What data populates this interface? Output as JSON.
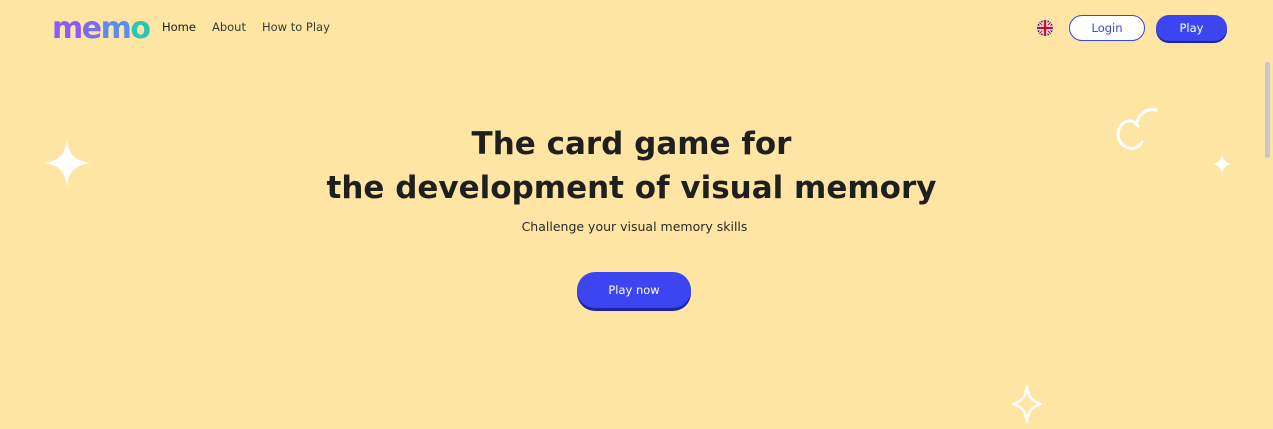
{
  "brand": {
    "logo_letters": [
      "m",
      "e",
      "m",
      "o"
    ],
    "colors": [
      "#8B5CF6",
      "#7C6CF0",
      "#5B8DEF",
      "#2EC4B6"
    ]
  },
  "nav": {
    "items": [
      {
        "label": "Home",
        "active": true
      },
      {
        "label": "About",
        "active": false
      },
      {
        "label": "How to Play",
        "active": false
      }
    ]
  },
  "header": {
    "language_icon": "uk-flag-icon",
    "login_label": "Login",
    "play_label": "Play"
  },
  "hero": {
    "title_line1": "The card game for",
    "title_line2": "the development of visual memory",
    "subtitle": "Challenge your visual memory skills",
    "cta_label": "Play now"
  },
  "decorations": [
    "sparkle-icon",
    "sparkle-icon",
    "sparkle-icon",
    "swirl-icon"
  ],
  "theme": {
    "background": "#FFE5A3",
    "accent": "#3B45F0",
    "text": "#1f1f1f"
  }
}
